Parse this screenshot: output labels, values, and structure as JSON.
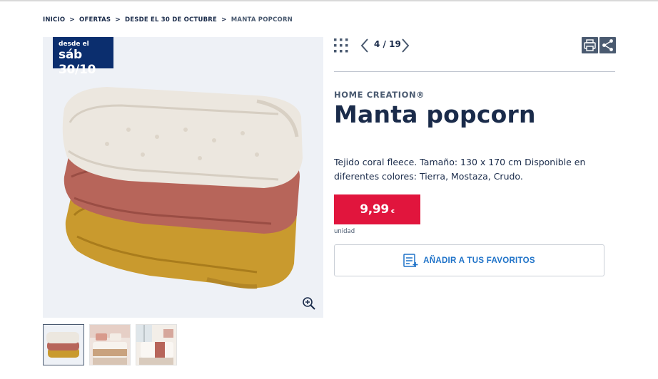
{
  "breadcrumb": {
    "items": [
      "INICIO",
      "OFERTAS",
      "DESDE EL 30 DE OCTUBRE"
    ],
    "current": "MANTA POPCORN",
    "separator": ">"
  },
  "badge": {
    "small": "desde el",
    "big": "sáb 30/10"
  },
  "gallery": {
    "counter": "4 / 19",
    "thumbnails": [
      "thumb-blankets-stack",
      "thumb-bedroom-pink",
      "thumb-bedroom-window"
    ]
  },
  "product": {
    "brand": "HOME CREATION®",
    "title": "Manta popcorn",
    "description": "Tejido coral fleece. Tamaño: 130 x 170 cm Disponible en diferentes colores: Tierra, Mostaza, Crudo.",
    "price": "9,99",
    "currency": "€",
    "unit": "unidad"
  },
  "favorites": {
    "label": "AÑADIR A TUS FAVORITOS"
  },
  "colors": {
    "navy": "#1a2b4a",
    "badge": "#0b2e6e",
    "price_red": "#e1153d",
    "link_blue": "#1e72c8",
    "icon_grey": "#4a5a70"
  },
  "icons": [
    "grid-icon",
    "chevron-left-icon",
    "chevron-right-icon",
    "print-icon",
    "share-icon",
    "zoom-in-icon",
    "favorites-list-icon"
  ]
}
